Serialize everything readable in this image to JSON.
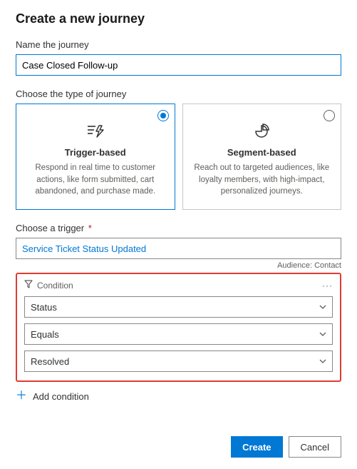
{
  "title": "Create a new journey",
  "name_field": {
    "label": "Name the journey",
    "value": "Case Closed Follow-up"
  },
  "type_section": {
    "label": "Choose the type of journey",
    "options": [
      {
        "title": "Trigger-based",
        "desc": "Respond in real time to customer actions, like form submitted, cart abandoned, and purchase made."
      },
      {
        "title": "Segment-based",
        "desc": "Reach out to targeted audiences, like loyalty members, with high-impact, personalized journeys."
      }
    ]
  },
  "trigger_section": {
    "label": "Choose a trigger",
    "required_mark": "*",
    "value": "Service Ticket Status Updated",
    "audience_prefix": "Audience: ",
    "audience_value": "Contact"
  },
  "condition": {
    "header": "Condition",
    "attribute": "Status",
    "operator": "Equals",
    "value": "Resolved"
  },
  "add_condition_label": "Add condition",
  "buttons": {
    "create": "Create",
    "cancel": "Cancel"
  }
}
